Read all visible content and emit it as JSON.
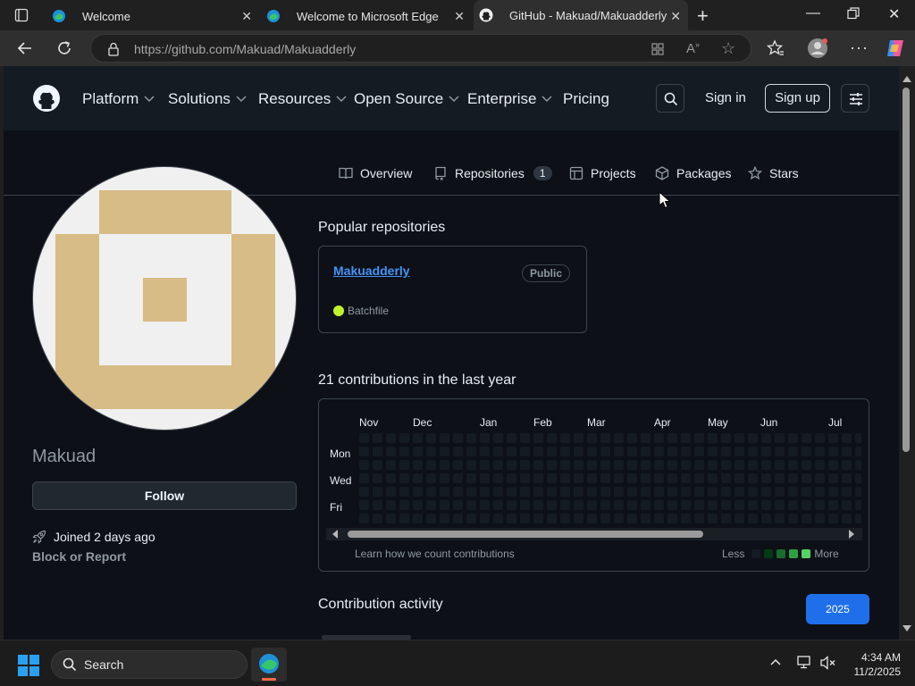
{
  "browser": {
    "tabs": [
      {
        "title": "Welcome",
        "icon": "edge-icon"
      },
      {
        "title": "Welcome to Microsoft Edge",
        "icon": "edge-icon"
      },
      {
        "title": "GitHub - Makuad/Makuadderly",
        "icon": "github-icon"
      }
    ],
    "url_host": "https://github.com",
    "url_path": "/Makuad/Makuadderly"
  },
  "header": {
    "nav": [
      "Platform",
      "Solutions",
      "Resources",
      "Open Source",
      "Enterprise",
      "Pricing"
    ],
    "sign_in": "Sign in",
    "sign_up": "Sign up"
  },
  "profile_tabs": {
    "overview": "Overview",
    "repositories": "Repositories",
    "repo_count": "1",
    "projects": "Projects",
    "packages": "Packages",
    "stars": "Stars"
  },
  "profile": {
    "username": "Makuad",
    "follow": "Follow",
    "joined": "Joined 2 days ago",
    "block": "Block or Report"
  },
  "popular": {
    "heading": "Popular repositories",
    "repo_name": "Makuadderly",
    "visibility": "Public",
    "language": "Batchfile",
    "language_color": "#c1f12e"
  },
  "contributions": {
    "heading": "21 contributions in the last year",
    "months": [
      "Nov",
      "Dec",
      "Jan",
      "Feb",
      "Mar",
      "Apr",
      "May",
      "Jun",
      "Jul"
    ],
    "days": [
      "Mon",
      "Wed",
      "Fri"
    ],
    "learn": "Learn how we count contributions",
    "less": "Less",
    "more": "More"
  },
  "activity": {
    "heading": "Contribution activity",
    "year": "2025"
  },
  "taskbar": {
    "search": "Search",
    "time": "4:34 AM",
    "date": "11/2/2025"
  }
}
